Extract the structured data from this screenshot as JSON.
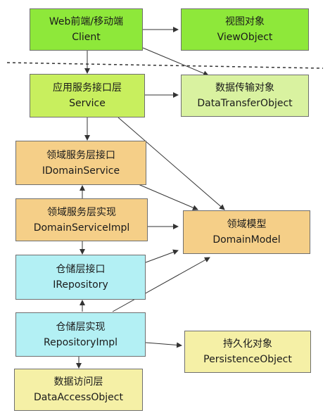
{
  "nodes": {
    "client": {
      "title": "Web前端/移动端",
      "subtitle": "Client"
    },
    "view_object": {
      "title": "视图对象",
      "subtitle": "ViewObject"
    },
    "service": {
      "title": "应用服务接口层",
      "subtitle": "Service"
    },
    "data_transfer_object": {
      "title": "数据传输对象",
      "subtitle": "DataTransferObject"
    },
    "domain_service": {
      "title": "领域服务层接口",
      "subtitle": "IDomainService"
    },
    "domain_service_impl": {
      "title": "领域服务层实现",
      "subtitle": "DomainServiceImpl"
    },
    "domain_model": {
      "title": "领域模型",
      "subtitle": "DomainModel"
    },
    "repository": {
      "title": "仓储层接口",
      "subtitle": "IRepository"
    },
    "repository_impl": {
      "title": "仓储层实现",
      "subtitle": "RepositoryImpl"
    },
    "persistence_object": {
      "title": "持久化对象",
      "subtitle": "PersistenceObject"
    },
    "data_access_object": {
      "title": "数据访问层",
      "subtitle": "DataAccessObject"
    }
  },
  "colors": {
    "client": "#8ee83a",
    "service": "#c8ef5e",
    "dto": "#d9f2a0",
    "domain": "#f5cf88",
    "repository": "#b3f0f4",
    "data": "#f5f0a6",
    "line": "#333333"
  }
}
